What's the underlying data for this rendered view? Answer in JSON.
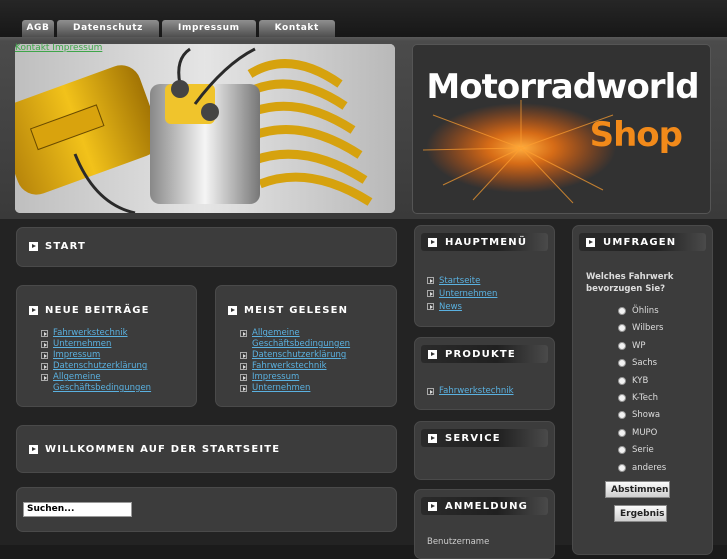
{
  "nav": {
    "items": [
      "AGB",
      "Datenschutz",
      "Impressum",
      "Kontakt"
    ]
  },
  "top_link": "Kontakt Impressum",
  "logo": {
    "line1": "Motorradworld",
    "line2": "Shop",
    "brand_color": "#f28a1a"
  },
  "start": {
    "title": "START"
  },
  "neue_beitraege": {
    "title": "NEUE BEITRÄGE",
    "items": [
      "Fahrwerkstechnik",
      "Unternehmen",
      "Impressum",
      "Datenschutzerklärung",
      "Allgemeine Geschäftsbedingungen"
    ]
  },
  "meist_gelesen": {
    "title": "MEIST GELESEN",
    "items": [
      "Allgemeine Geschäftsbedingungen",
      "Datenschutzerklärung",
      "Fahrwerkstechnik",
      "Impressum",
      "Unternehmen"
    ]
  },
  "welcome": {
    "title": "WILLKOMMEN AUF DER STARTSEITE"
  },
  "search": {
    "placeholder": "Suchen..."
  },
  "hauptmenu": {
    "title": "HAUPTMENÜ",
    "items": [
      "Startseite",
      "Unternehmen",
      "News"
    ]
  },
  "produkte": {
    "title": "PRODUKTE",
    "items": [
      "Fahrwerkstechnik"
    ]
  },
  "service": {
    "title": "SERVICE"
  },
  "anmeldung": {
    "title": "ANMELDUNG",
    "username_label": "Benutzername"
  },
  "umfragen": {
    "title": "UMFRAGEN",
    "question": "Welches Fahrwerk bevorzugen Sie?",
    "options": [
      "Öhlins",
      "Wilbers",
      "WP",
      "Sachs",
      "KYB",
      "K-Tech",
      "Showa",
      "MUPO",
      "Serie",
      "anderes"
    ],
    "vote_label": "Abstimmen",
    "results_label": "Ergebnis"
  }
}
